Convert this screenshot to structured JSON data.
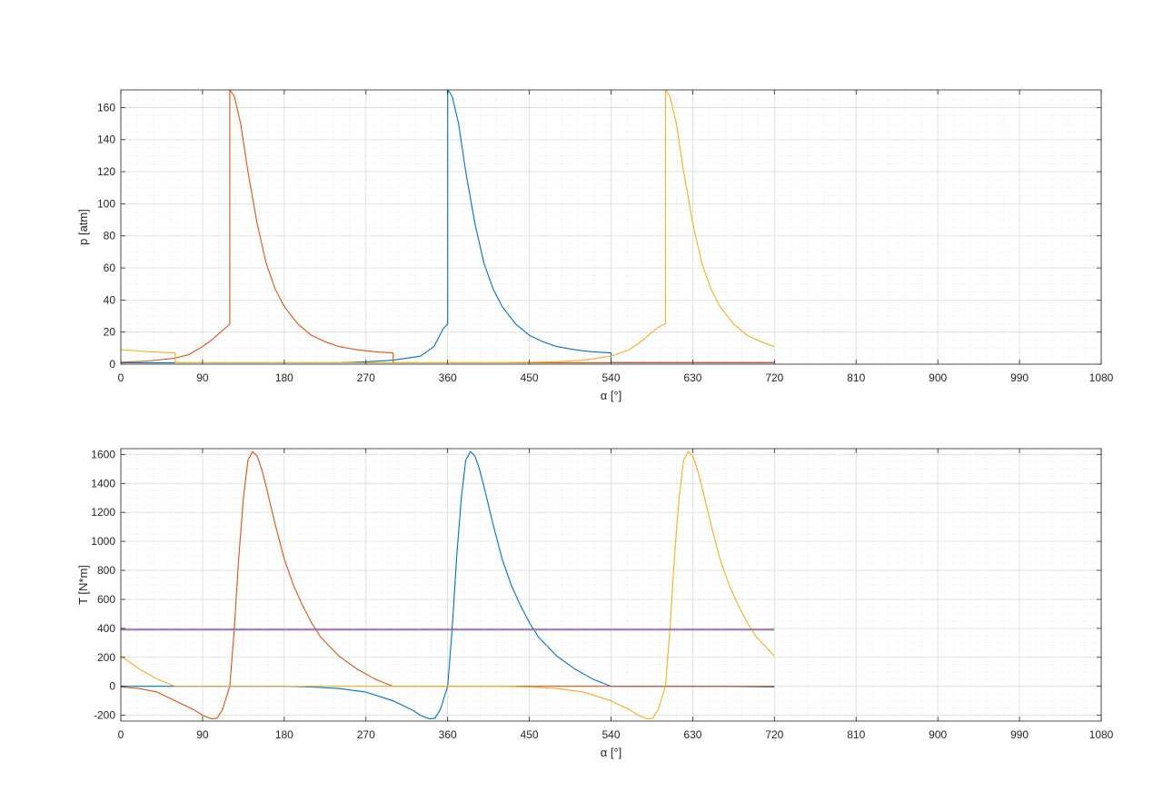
{
  "chart_data": [
    {
      "type": "line",
      "ylabel": "p [atm]",
      "xlabel": "α [°]",
      "xlim": [
        0,
        1080
      ],
      "ylim": [
        0,
        171
      ],
      "xticks": [
        "0",
        "90",
        "180",
        "270",
        "360",
        "450",
        "540",
        "630",
        "720",
        "810",
        "900",
        "990",
        "1080"
      ],
      "yticks": [
        "0",
        "20",
        "40",
        "60",
        "80",
        "100",
        "120",
        "140",
        "160"
      ],
      "grid": true,
      "minor_grid": true,
      "series": [
        {
          "color": "#0072BD",
          "x": [
            0,
            60,
            120,
            180,
            240,
            270,
            300,
            330,
            345,
            355,
            360,
            360,
            365,
            372,
            380,
            390,
            400,
            410,
            420,
            435,
            450,
            465,
            480,
            500,
            520,
            540,
            540,
            600,
            660,
            720
          ],
          "y": [
            0.9,
            0.9,
            0.9,
            0.9,
            0.9,
            1.5,
            2.5,
            5,
            11,
            22,
            25,
            171,
            167,
            150,
            120,
            88,
            63,
            47,
            36,
            25,
            18,
            14,
            11,
            9,
            7.7,
            7,
            1,
            1,
            1,
            1
          ]
        },
        {
          "color": "#D95319",
          "x": [
            0,
            30,
            60,
            75,
            90,
            100,
            110,
            118,
            120,
            120,
            125,
            132,
            140,
            150,
            160,
            170,
            180,
            195,
            210,
            225,
            240,
            260,
            280,
            300,
            300,
            360,
            420,
            480,
            540,
            720
          ],
          "y": [
            1.2,
            2,
            3.8,
            6,
            11,
            15,
            20,
            24,
            25,
            171,
            167,
            150,
            120,
            88,
            63,
            47,
            36,
            25,
            18,
            14,
            11,
            9,
            7.7,
            7,
            0.9,
            0.9,
            0.9,
            0.9,
            0.9,
            0.9
          ]
        },
        {
          "color": "#EDB120",
          "x": [
            0,
            20,
            40,
            60,
            60,
            120,
            180,
            240,
            300,
            360,
            420,
            480,
            510,
            540,
            560,
            575,
            585,
            595,
            600,
            600,
            605,
            612,
            620,
            630,
            640,
            650,
            660,
            675,
            690,
            705,
            720
          ],
          "y": [
            9,
            8.2,
            7.5,
            7,
            0.9,
            0.9,
            0.9,
            0.9,
            0.9,
            0.9,
            0.9,
            1.5,
            2.5,
            5,
            9,
            15,
            20,
            24,
            25,
            171,
            167,
            150,
            120,
            88,
            63,
            47,
            36,
            25,
            18,
            14,
            11
          ]
        }
      ]
    },
    {
      "type": "line",
      "ylabel": "T [N*m]",
      "xlabel": "α [°]",
      "xlim": [
        0,
        1080
      ],
      "ylim": [
        -240,
        1640
      ],
      "xticks": [
        "0",
        "90",
        "180",
        "270",
        "360",
        "450",
        "540",
        "630",
        "720",
        "810",
        "900",
        "990",
        "1080"
      ],
      "yticks": [
        "-200",
        "0",
        "200",
        "400",
        "600",
        "800",
        "1000",
        "1200",
        "1400",
        "1600"
      ],
      "grid": true,
      "minor_grid": true,
      "series": [
        {
          "color": "#0072BD",
          "x": [
            0,
            60,
            120,
            180,
            210,
            240,
            270,
            300,
            320,
            330,
            340,
            346,
            352,
            356,
            360,
            365,
            370,
            375,
            380,
            385,
            390,
            395,
            400,
            410,
            420,
            430,
            440,
            450,
            460,
            480,
            500,
            520,
            540,
            600,
            660,
            720
          ],
          "y": [
            0,
            0,
            0,
            0,
            -5,
            -15,
            -40,
            -100,
            -160,
            -200,
            -225,
            -220,
            -160,
            -80,
            0,
            400,
            900,
            1300,
            1560,
            1620,
            1590,
            1500,
            1380,
            1120,
            880,
            700,
            560,
            440,
            340,
            210,
            120,
            50,
            0,
            0,
            0,
            -5
          ]
        },
        {
          "color": "#D95319",
          "x": [
            0,
            20,
            40,
            60,
            80,
            90,
            100,
            106,
            112,
            116,
            120,
            125,
            130,
            135,
            140,
            145,
            150,
            155,
            160,
            170,
            180,
            190,
            200,
            210,
            220,
            240,
            260,
            280,
            300,
            360,
            420,
            480,
            540,
            600,
            660,
            720
          ],
          "y": [
            -5,
            -15,
            -40,
            -100,
            -160,
            -200,
            -225,
            -220,
            -160,
            -80,
            0,
            400,
            900,
            1300,
            1560,
            1620,
            1590,
            1500,
            1380,
            1120,
            880,
            700,
            560,
            440,
            340,
            210,
            120,
            50,
            0,
            0,
            0,
            0,
            0,
            0,
            0,
            0
          ]
        },
        {
          "color": "#EDB120",
          "x": [
            0,
            20,
            40,
            60,
            120,
            180,
            240,
            300,
            360,
            420,
            450,
            480,
            510,
            540,
            560,
            570,
            580,
            586,
            592,
            596,
            600,
            605,
            610,
            615,
            620,
            625,
            630,
            635,
            640,
            650,
            660,
            670,
            680,
            690,
            700,
            720
          ],
          "y": [
            210,
            120,
            50,
            0,
            0,
            0,
            0,
            0,
            0,
            0,
            -5,
            -15,
            -40,
            -100,
            -160,
            -200,
            -225,
            -220,
            -160,
            -80,
            0,
            400,
            900,
            1300,
            1560,
            1620,
            1590,
            1500,
            1380,
            1120,
            880,
            700,
            560,
            440,
            340,
            210
          ]
        },
        {
          "color": "#7E2F8E",
          "x": [
            0,
            720
          ],
          "y": [
            393,
            393
          ]
        },
        {
          "color": "#B3A6C9",
          "x": [
            0,
            720
          ],
          "y": [
            387,
            387
          ]
        }
      ]
    }
  ]
}
